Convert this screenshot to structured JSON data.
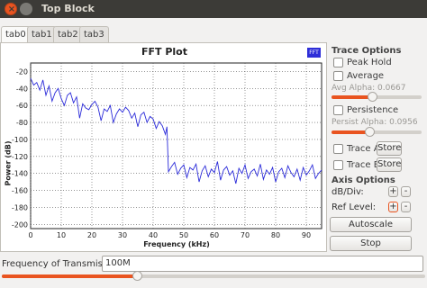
{
  "window": {
    "title": "Top Block",
    "close_glyph": "×"
  },
  "tabs": [
    {
      "label": "tab0",
      "active": true
    },
    {
      "label": "tab1",
      "active": false
    },
    {
      "label": "tab2",
      "active": false
    },
    {
      "label": "tab3",
      "active": false
    }
  ],
  "plot": {
    "legend_label": "FFT"
  },
  "chart_data": {
    "type": "line",
    "title": "FFT Plot",
    "xlabel": "Frequency (kHz)",
    "ylabel": "Power (dB)",
    "xlim": [
      0,
      95
    ],
    "ylim": [
      -205,
      -10
    ],
    "x_ticks": [
      0,
      10,
      20,
      30,
      40,
      50,
      60,
      70,
      80,
      90
    ],
    "y_ticks": [
      -20,
      -40,
      -60,
      -80,
      -100,
      -120,
      -140,
      -160,
      -180,
      -200
    ],
    "grid": true,
    "series": [
      {
        "color": "#2b2bd9",
        "x": [
          0,
          1,
          2,
          3,
          4,
          5,
          6,
          7,
          8,
          9,
          10,
          11,
          12,
          13,
          14,
          15,
          16,
          17,
          18,
          19,
          20,
          21,
          22,
          23,
          24,
          25,
          26,
          27,
          28,
          29,
          30,
          31,
          32,
          33,
          34,
          35,
          36,
          37,
          38,
          39,
          40,
          41,
          42,
          43,
          44,
          44.5,
          45,
          46,
          47,
          48,
          49,
          50,
          51,
          52,
          53,
          54,
          55,
          56,
          57,
          58,
          59,
          60,
          61,
          62,
          63,
          64,
          65,
          66,
          67,
          68,
          69,
          70,
          71,
          72,
          73,
          74,
          75,
          76,
          77,
          78,
          79,
          80,
          81,
          82,
          83,
          84,
          85,
          86,
          87,
          88,
          89,
          90,
          91,
          92,
          93,
          94,
          95
        ],
        "y": [
          -28,
          -36,
          -33,
          -42,
          -30,
          -48,
          -37,
          -55,
          -45,
          -40,
          -52,
          -60,
          -48,
          -45,
          -57,
          -50,
          -75,
          -58,
          -63,
          -65,
          -59,
          -55,
          -62,
          -78,
          -64,
          -67,
          -60,
          -80,
          -70,
          -64,
          -68,
          -62,
          -66,
          -75,
          -69,
          -85,
          -71,
          -68,
          -80,
          -73,
          -76,
          -87,
          -79,
          -84,
          -94,
          -85,
          -138,
          -132,
          -127,
          -141,
          -134,
          -130,
          -145,
          -133,
          -136,
          -129,
          -150,
          -137,
          -131,
          -144,
          -135,
          -139,
          -126,
          -148,
          -136,
          -132,
          -142,
          -137,
          -152,
          -134,
          -140,
          -130,
          -146,
          -138,
          -135,
          -143,
          -129,
          -147,
          -136,
          -141,
          -133,
          -150,
          -138,
          -134,
          -145,
          -131,
          -139,
          -144,
          -135,
          -148,
          -133,
          -142,
          -137,
          -130,
          -146,
          -140,
          -136
        ]
      }
    ]
  },
  "options": {
    "trace_title": "Trace Options",
    "peak_hold": "Peak Hold",
    "average": "Average",
    "avg_alpha": "Avg Alpha: 0.0667",
    "avg_alpha_level": 0.45,
    "persistence": "Persistence",
    "persist_alpha": "Persist Alpha: 0.0956",
    "persist_alpha_level": 0.42,
    "trace_a": "Trace A",
    "trace_b": "Trace B",
    "store_label": "Store",
    "axis_title": "Axis Options",
    "db_div": "dB/Div:",
    "ref_level": "Ref Level:",
    "plus_glyph": "+",
    "minus_glyph": "-",
    "autoscale": "Autoscale",
    "stop": "Stop"
  },
  "transmission": {
    "label": "Frequency of Transmission:",
    "value": "100M",
    "slider_level": 0.32
  },
  "colors": {
    "accent": "#e95420",
    "trace": "#2b2bd9",
    "titlebar": "#3c3b37"
  }
}
